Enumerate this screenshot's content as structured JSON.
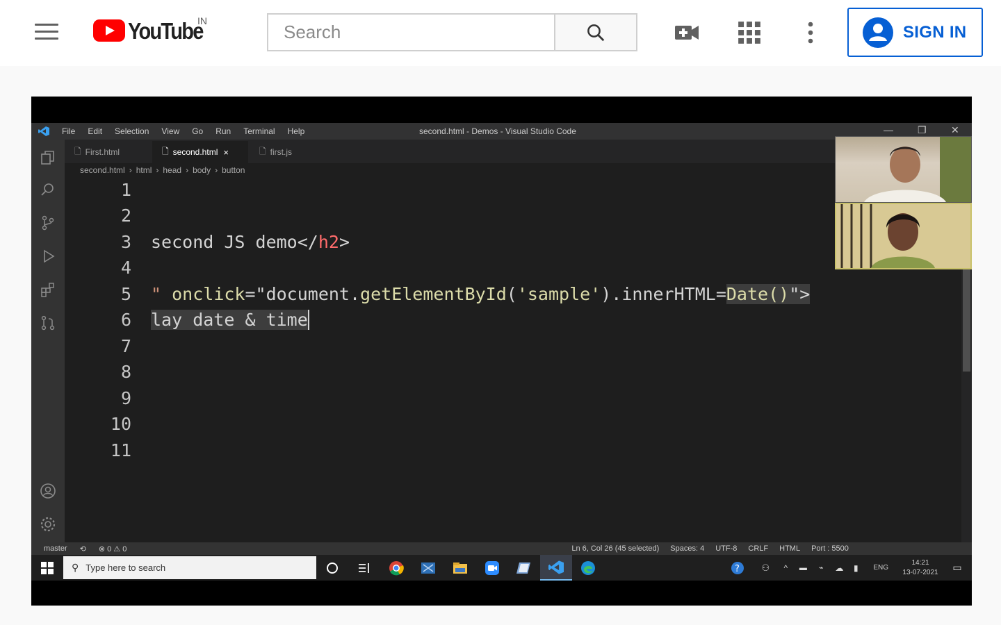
{
  "header": {
    "logo_text": "YouTube",
    "region": "IN",
    "search_placeholder": "Search",
    "sign_in": "SIGN IN"
  },
  "colors": {
    "yt_red": "#ff0000",
    "signin_blue": "#065fd4",
    "editor_bg": "#1e1e1e"
  },
  "video": {
    "vscode": {
      "menu": [
        "File",
        "Edit",
        "Selection",
        "View",
        "Go",
        "Run",
        "Terminal",
        "Help"
      ],
      "window_title": "second.html - Demos - Visual Studio Code",
      "tabs": [
        {
          "label": "First.html",
          "active": false
        },
        {
          "label": "second.html",
          "active": true,
          "close": "×"
        },
        {
          "label": "first.js",
          "active": false
        }
      ],
      "breadcrumbs": [
        "second.html",
        "html",
        "head",
        "body",
        "button"
      ],
      "line_numbers": [
        "1",
        "2",
        "3",
        "4",
        "5",
        "6",
        "7",
        "8",
        "9",
        "10",
        "11"
      ],
      "code": {
        "line3_a": "second JS demo</",
        "line3_tag": "h2",
        "line3_b": ">",
        "line5_a": "\" ",
        "line5_attr": "onclick",
        "line5_b": "=\"document.",
        "line5_fn": "getElementById",
        "line5_c": "(",
        "line5_str": "'sample'",
        "line5_d": ").innerHTML=",
        "line5_hl": "Date()",
        "line5_e": "\">",
        "line6": "lay date & time"
      },
      "status_left": [
        "master",
        "⊗ 0 ⚠ 0"
      ],
      "status_right": [
        "Ln 6, Col 26 (45 selected)",
        "Spaces: 4",
        "UTF-8",
        "CRLF",
        "HTML",
        "Port : 5500"
      ]
    },
    "taskbar": {
      "search_placeholder": "Type here to search",
      "lang": "ENG",
      "time": "14:21",
      "date": "13-07-2021"
    }
  }
}
